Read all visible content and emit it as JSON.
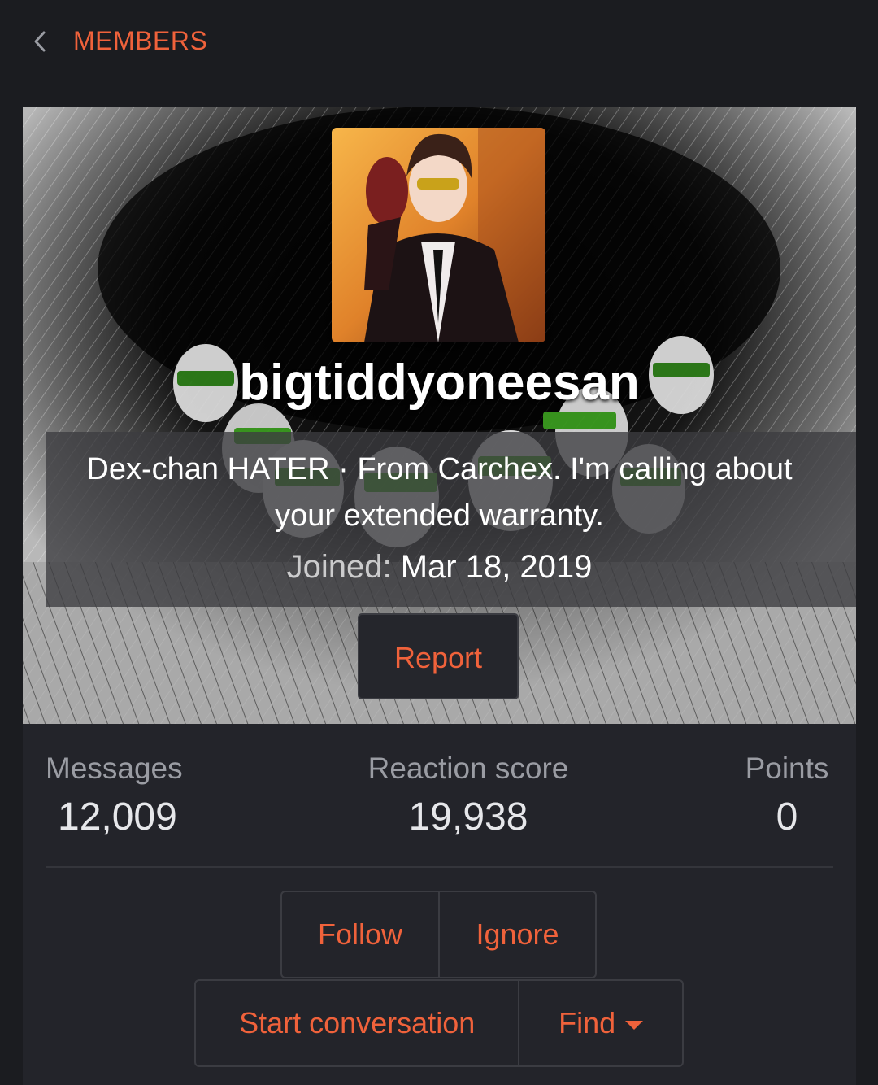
{
  "colors": {
    "accent": "#f0623b",
    "text_primary": "#ffffff",
    "text_muted": "#9a9ca3",
    "stat_value": "#e6e7ea",
    "background": "#1b1c20",
    "card": "#23242a"
  },
  "nav": {
    "back_icon": "chevron-left-icon",
    "title": "MEMBERS"
  },
  "profile": {
    "username": "bigtiddyoneesan",
    "tagline": "Dex-chan HATER · From Carchex. I'm calling about your extended warranty.",
    "joined_label": "Joined:",
    "joined_date": "Mar 18, 2019",
    "report_label": "Report"
  },
  "stats": [
    {
      "label": "Messages",
      "value": "12,009"
    },
    {
      "label": "Reaction score",
      "value": "19,938"
    },
    {
      "label": "Points",
      "value": "0"
    }
  ],
  "actions": {
    "follow_label": "Follow",
    "ignore_label": "Ignore",
    "start_conversation_label": "Start conversation",
    "find_label": "Find",
    "find_icon": "caret-down-icon"
  }
}
